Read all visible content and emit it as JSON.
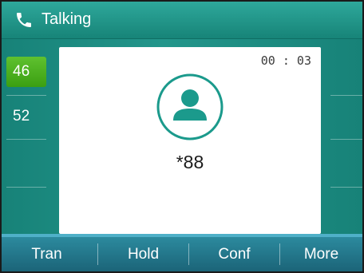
{
  "header": {
    "title": "Talking",
    "icon": "phone-icon"
  },
  "lines": [
    {
      "label": "46",
      "active": true
    },
    {
      "label": "52",
      "active": false
    }
  ],
  "call": {
    "timer": "00 : 03",
    "number": "*88",
    "avatar_icon": "contact-avatar-icon"
  },
  "softkeys": [
    {
      "label": "Tran"
    },
    {
      "label": "Hold"
    },
    {
      "label": "Conf"
    },
    {
      "label": "More"
    }
  ],
  "colors": {
    "header": "#2ea89b",
    "body": "#1f8f84",
    "active_line": "#4cae20",
    "avatar": "#1b9a8c",
    "softkey_bar": "#1f6e82"
  }
}
